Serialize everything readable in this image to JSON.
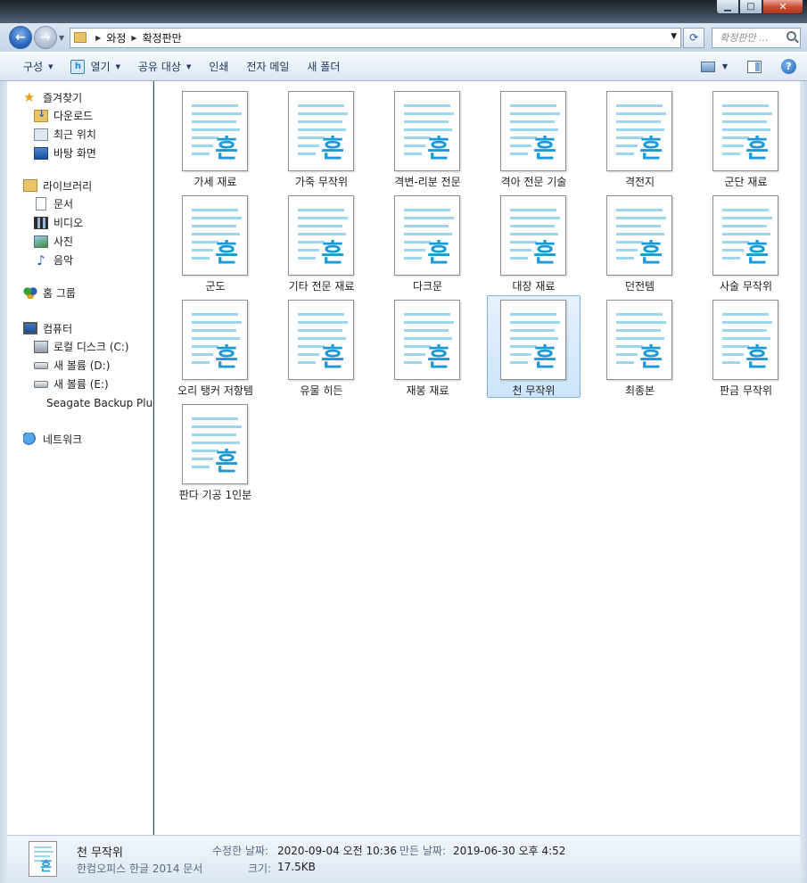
{
  "window": {
    "caption_buttons": {
      "minimize": "▁",
      "maximize": "□",
      "close": "✕"
    }
  },
  "address": {
    "path": [
      "와정",
      "확정판만"
    ],
    "search_placeholder": "확정판만 ..."
  },
  "toolbar": {
    "organize": "구성",
    "open": "열기",
    "share": "공유 대상",
    "print": "인쇄",
    "email": "전자 메일",
    "new_folder": "새 폴더"
  },
  "nav": {
    "favorites": {
      "label": "즐겨찾기",
      "items": [
        "다운로드",
        "최근 위치",
        "바탕 화면"
      ]
    },
    "libraries": {
      "label": "라이브러리",
      "items": [
        "문서",
        "비디오",
        "사진",
        "음악"
      ]
    },
    "homegroup": {
      "label": "홈 그룹"
    },
    "computer": {
      "label": "컴퓨터",
      "items": [
        "로컬 디스크 (C:)",
        "새 볼륨 (D:)",
        "새 볼륨 (E:)",
        "Seagate Backup Plus"
      ]
    },
    "network": {
      "label": "네트워크"
    }
  },
  "files": [
    {
      "name": "가세 재료",
      "selected": false
    },
    {
      "name": "가죽 무작위",
      "selected": false
    },
    {
      "name": "격변-리분 전문",
      "selected": false
    },
    {
      "name": "격아 전문 기술",
      "selected": false
    },
    {
      "name": "격전지",
      "selected": false
    },
    {
      "name": "군단 재료",
      "selected": false
    },
    {
      "name": "군도",
      "selected": false
    },
    {
      "name": "기타 전문 재료",
      "selected": false
    },
    {
      "name": "다크문",
      "selected": false
    },
    {
      "name": "대장 재료",
      "selected": false
    },
    {
      "name": "던전템",
      "selected": false
    },
    {
      "name": "사술 무작위",
      "selected": false
    },
    {
      "name": "오리 탱커 저항템",
      "selected": false
    },
    {
      "name": "유물 히든",
      "selected": false
    },
    {
      "name": "재봉 재료",
      "selected": false
    },
    {
      "name": "천 무작위",
      "selected": true
    },
    {
      "name": "최종본",
      "selected": false
    },
    {
      "name": "판금 무작위",
      "selected": false
    },
    {
      "name": "판다 기공 1인분",
      "selected": false
    }
  ],
  "file_icon_glyph": "흔",
  "details": {
    "name": "천 무작위",
    "type": "한컴오피스 한글 2014 문서",
    "modified_label": "수정한 날짜:",
    "modified_value": "2020-09-04 오전 10:36",
    "created_label": "만든 날짜:",
    "created_value": "2019-06-30 오후 4:52",
    "size_label": "크기:",
    "size_value": "17.5KB"
  },
  "colors": {
    "accent": "#1b9ad6",
    "selection": "#cce4fa"
  }
}
